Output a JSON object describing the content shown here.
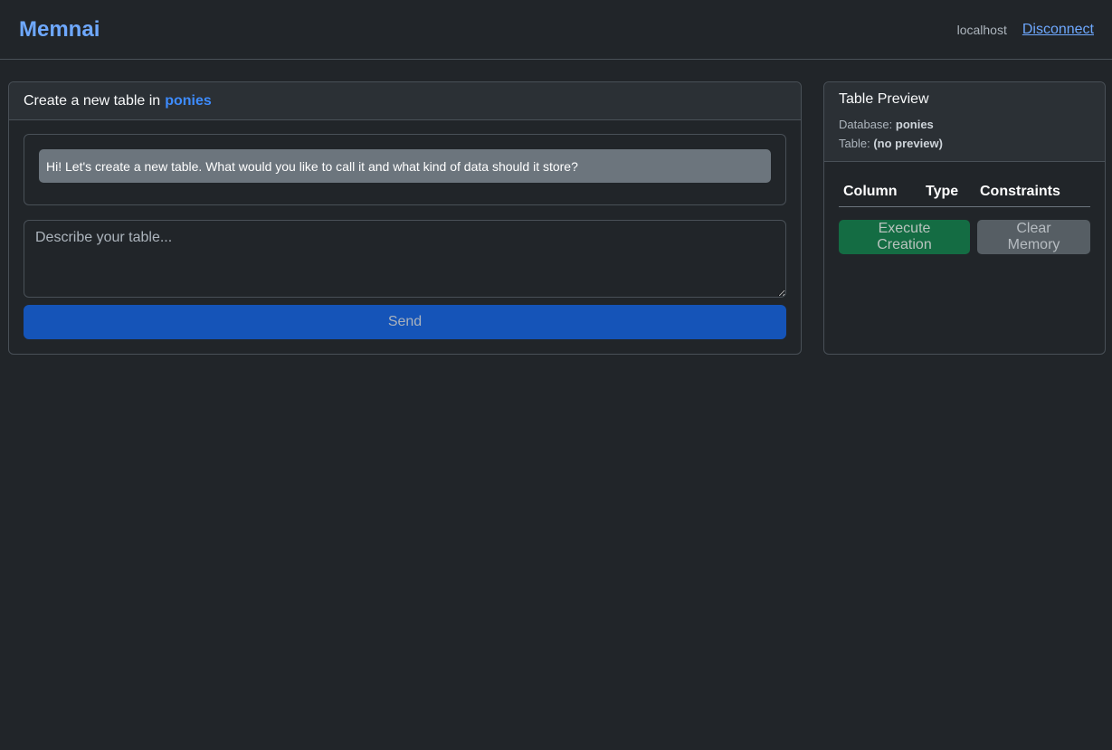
{
  "navbar": {
    "brand": "Memnai",
    "host": "localhost",
    "disconnect_label": "Disconnect"
  },
  "chat": {
    "header_prefix": "Create a new table in",
    "database": "ponies",
    "messages": [
      {
        "role": "assistant",
        "text": "Hi! Let's create a new table. What would you like to call it and what kind of data should it store?"
      }
    ],
    "input": {
      "placeholder": "Describe your table...",
      "value": ""
    },
    "send_label": "Send"
  },
  "preview": {
    "title": "Table Preview",
    "database_label": "Database:",
    "database_value": "ponies",
    "table_label": "Table:",
    "table_value": "(no preview)",
    "columns": [
      "Column",
      "Type",
      "Constraints"
    ],
    "execute_label": "Execute Creation",
    "clear_label": "Clear Memory"
  },
  "colors": {
    "background": "#212529",
    "brand": "#6ea8fe",
    "primary": "#1554b8",
    "success": "#146c43",
    "secondary": "#565e64"
  }
}
